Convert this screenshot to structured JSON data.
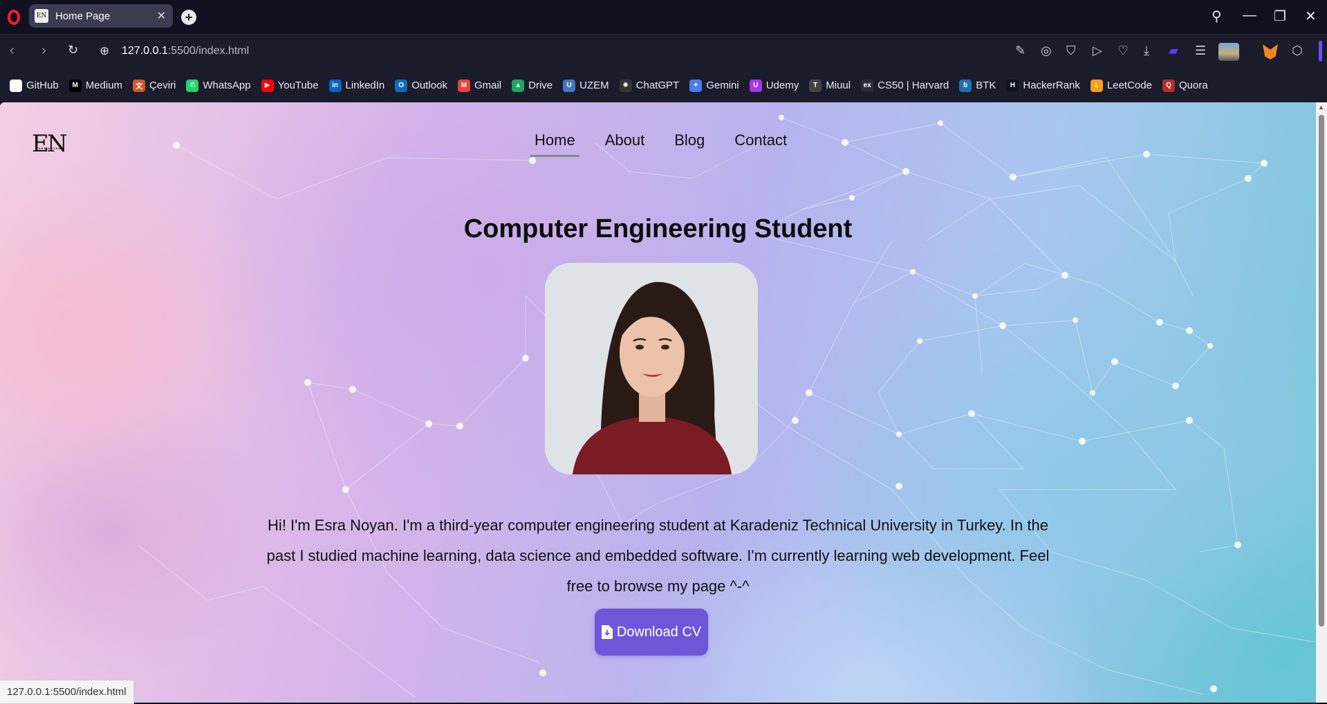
{
  "browser": {
    "tab_title": "Home Page",
    "tab_favicon_text": "EN",
    "url_host": "127.0.0.1",
    "url_rest": ":5500/index.html",
    "status_url": "127.0.0.1:5500/index.html"
  },
  "bookmarks": [
    {
      "label": "GitHub",
      "icon": "github-icon",
      "color": "#ffffff",
      "glyph": "◉"
    },
    {
      "label": "Medium",
      "icon": "medium-icon",
      "color": "#000000",
      "glyph": "M"
    },
    {
      "label": "Çeviri",
      "icon": "translate-icon",
      "color": "#d9532b",
      "glyph": "文"
    },
    {
      "label": "WhatsApp",
      "icon": "whatsapp-icon",
      "color": "#25d366",
      "glyph": "✆"
    },
    {
      "label": "YouTube",
      "icon": "youtube-icon",
      "color": "#ff0000",
      "glyph": "▶"
    },
    {
      "label": "LinkedIn",
      "icon": "linkedin-icon",
      "color": "#0a66c2",
      "glyph": "in"
    },
    {
      "label": "Outlook",
      "icon": "outlook-icon",
      "color": "#0f6cbd",
      "glyph": "O"
    },
    {
      "label": "Gmail",
      "icon": "gmail-icon",
      "color": "#ea4335",
      "glyph": "M"
    },
    {
      "label": "Drive",
      "icon": "drive-icon",
      "color": "#1fa463",
      "glyph": "▲"
    },
    {
      "label": "UZEM",
      "icon": "uzem-icon",
      "color": "#3f78c2",
      "glyph": "U"
    },
    {
      "label": "ChatGPT",
      "icon": "chatgpt-icon",
      "color": "#333333",
      "glyph": "✺"
    },
    {
      "label": "Gemini",
      "icon": "gemini-icon",
      "color": "#4a7cf0",
      "glyph": "✦"
    },
    {
      "label": "Udemy",
      "icon": "udemy-icon",
      "color": "#a435f0",
      "glyph": "U"
    },
    {
      "label": "Miuul",
      "icon": "miuul-icon",
      "color": "#444444",
      "glyph": "T"
    },
    {
      "label": "CS50 | Harvard",
      "icon": "edx-icon",
      "color": "#2a2c3c",
      "glyph": "ex"
    },
    {
      "label": "BTK",
      "icon": "btk-icon",
      "color": "#1c6fb5",
      "glyph": "b"
    },
    {
      "label": "HackerRank",
      "icon": "hackerrank-icon",
      "color": "#0e141e",
      "glyph": "H"
    },
    {
      "label": "LeetCode",
      "icon": "leetcode-icon",
      "color": "#f89f1b",
      "glyph": "ʟ"
    },
    {
      "label": "Quora",
      "icon": "quora-icon",
      "color": "#b92b27",
      "glyph": "Q"
    }
  ],
  "site": {
    "logo": "EN",
    "logo_small": "ESRA NOYAN",
    "nav": [
      {
        "label": "Home",
        "active": true
      },
      {
        "label": "About",
        "active": false
      },
      {
        "label": "Blog",
        "active": false
      },
      {
        "label": "Contact",
        "active": false
      }
    ],
    "headline": "Computer Engineering Student",
    "bio": "Hi! I'm Esra Noyan. I'm a third-year computer engineering student at Karadeniz Technical University in Turkey. In the past I studied machine learning, data science and embedded software. I'm currently learning web development. Feel free to browse my page ^-^",
    "cv_button": "Download CV",
    "accent_color": "#6e56d8"
  }
}
